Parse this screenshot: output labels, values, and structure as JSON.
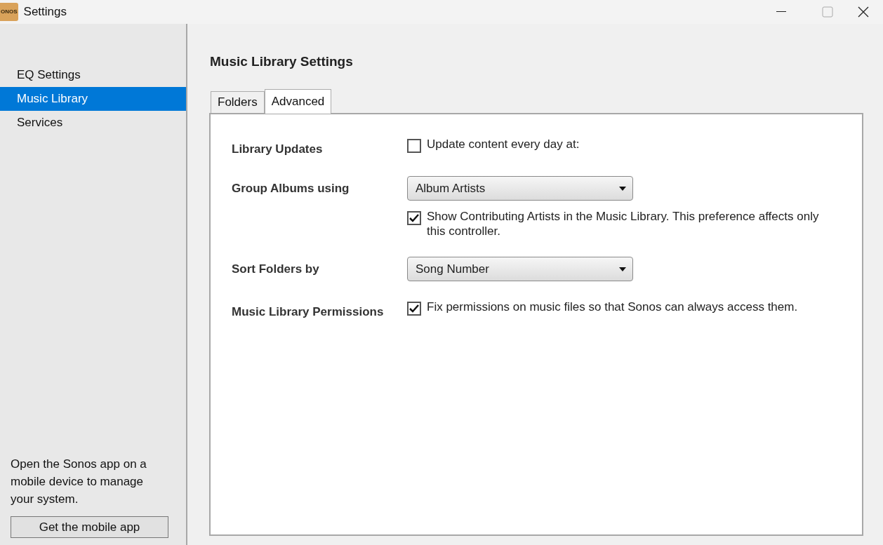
{
  "window": {
    "title": "Settings",
    "app_icon_text": "ONOS"
  },
  "sidebar": {
    "items": [
      {
        "label": "EQ Settings",
        "selected": false
      },
      {
        "label": "Music Library",
        "selected": true
      },
      {
        "label": "Services",
        "selected": false
      }
    ],
    "promo_text": "Open the Sonos app on a mobile device to manage your system.",
    "promo_button": "Get the mobile app"
  },
  "page_title": "Music Library Settings",
  "tabs": [
    {
      "label": "Folders",
      "selected": false
    },
    {
      "label": "Advanced",
      "selected": true
    }
  ],
  "settings": [
    {
      "label": "Library Updates",
      "controls": [
        {
          "kind": "checkbox",
          "label": "Update content every day at:",
          "checked": false
        }
      ]
    },
    {
      "label": "Group Albums using",
      "controls": [
        {
          "kind": "dropdown",
          "value": "Album Artists"
        },
        {
          "kind": "checkbox",
          "label": "Show Contributing Artists in the Music Library. This preference affects only this controller.",
          "checked": true
        }
      ]
    },
    {
      "label": "Sort Folders by",
      "controls": [
        {
          "kind": "dropdown",
          "value": "Song Number"
        }
      ]
    },
    {
      "label": "Music Library Permissions",
      "controls": [
        {
          "kind": "checkbox",
          "label": "Fix permissions on music files so that Sonos can always access them.",
          "checked": true
        }
      ]
    }
  ]
}
